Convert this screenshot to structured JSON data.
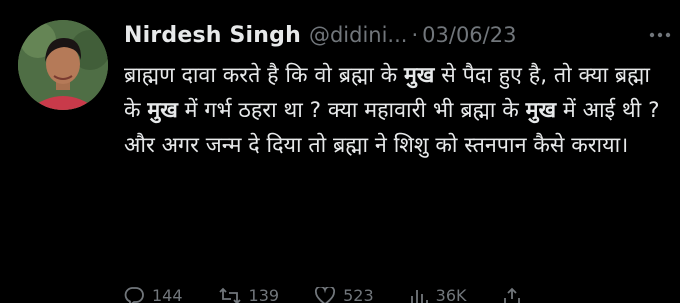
{
  "tweet": {
    "author_name": "Nirdesh Singh",
    "handle": "@didini...",
    "separator": "·",
    "date": "03/06/23",
    "text_segments": [
      {
        "t": "ब्राह्मण दावा करते है कि वो ब्रह्मा के ",
        "bold": false
      },
      {
        "t": "मुख",
        "bold": true
      },
      {
        "t": " से पैदा हुए है, तो क्या ब्रह्मा के ",
        "bold": false
      },
      {
        "t": "मुख",
        "bold": true
      },
      {
        "t": " में गर्भ ठहरा था ? क्या महावारी भी ब्रह्मा के ",
        "bold": false
      },
      {
        "t": "मुख",
        "bold": true
      },
      {
        "t": " में आई थी ? और अगर जन्म दे दिया तो ब्रह्मा ने शिशु को स्तनपान कैसे कराया।",
        "bold": false
      }
    ]
  },
  "actions": {
    "replies": "144",
    "retweets": "139",
    "likes": "523",
    "views": "36K"
  },
  "icons": [
    "more-icon",
    "reply-icon",
    "retweet-icon",
    "like-icon",
    "views-icon",
    "share-icon"
  ],
  "colors": {
    "background": "#000000",
    "primary_text": "#e7e9ea",
    "secondary_text": "#71767b"
  }
}
